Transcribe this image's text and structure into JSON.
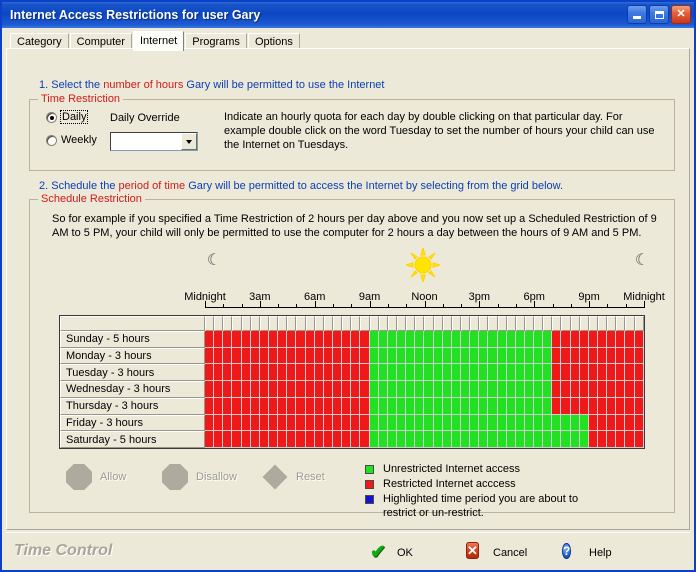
{
  "window": {
    "title": "Internet Access Restrictions for user Gary",
    "minimize_label": "Minimize",
    "maximize_label": "Maximize",
    "close_label": "Close"
  },
  "tabs": [
    {
      "label": "Category",
      "active": false
    },
    {
      "label": "Computer",
      "active": false
    },
    {
      "label": "Internet",
      "active": true
    },
    {
      "label": "Programs",
      "active": false
    },
    {
      "label": "Options",
      "active": false
    }
  ],
  "step1": {
    "prefix": "1. Select the ",
    "highlight": "number of hours",
    "suffix": " Gary will be permitted to use the Internet"
  },
  "time_restriction": {
    "group_label": "Time Restriction",
    "daily_label": "Daily",
    "weekly_label": "Weekly",
    "selected": "Daily",
    "override_label": "Daily Override",
    "override_value": "",
    "override_placeholder": "",
    "description": "Indicate an hourly quota for each day by double clicking on that particular day. For example double click on the word Tuesday to set the number of hours your child can use the Internet  on Tuesdays."
  },
  "step2": {
    "prefix": "2. Schedule the ",
    "highlight": "period of time",
    "suffix": " Gary will be permitted to access the Internet by selecting from the grid below."
  },
  "schedule_restriction": {
    "group_label": "Schedule Restriction",
    "description": "So for example if you specified a Time Restriction of 2 hours per day above and you now set up a Scheduled Restriction of 9 AM to 5 PM, your child will only be permitted to use the computer for 2 hours a day between the hours of 9 AM and 5 PM."
  },
  "time_axis": {
    "labels": [
      "Midnight",
      "3am",
      "6am",
      "9am",
      "Noon",
      "3pm",
      "6pm",
      "9pm",
      "Midnight"
    ],
    "left_icon": "moon-icon",
    "center_icon": "sun-icon",
    "right_icon": "moon-icon"
  },
  "grid": {
    "slots_per_day": 48,
    "rows": [
      {
        "day_label": "Sunday - 5 hours",
        "states": [
          "r",
          "r",
          "r",
          "r",
          "r",
          "r",
          "r",
          "r",
          "r",
          "r",
          "r",
          "r",
          "r",
          "r",
          "r",
          "r",
          "r",
          "r",
          "g",
          "g",
          "g",
          "g",
          "g",
          "g",
          "g",
          "g",
          "g",
          "g",
          "g",
          "g",
          "g",
          "g",
          "g",
          "g",
          "g",
          "g",
          "g",
          "g",
          "r",
          "r",
          "r",
          "r",
          "r",
          "r",
          "r",
          "r",
          "r",
          "r"
        ]
      },
      {
        "day_label": "Monday - 3 hours",
        "states": [
          "r",
          "r",
          "r",
          "r",
          "r",
          "r",
          "r",
          "r",
          "r",
          "r",
          "r",
          "r",
          "r",
          "r",
          "r",
          "r",
          "r",
          "r",
          "g",
          "g",
          "g",
          "g",
          "g",
          "g",
          "g",
          "g",
          "g",
          "g",
          "g",
          "g",
          "g",
          "g",
          "g",
          "g",
          "g",
          "g",
          "g",
          "g",
          "r",
          "r",
          "r",
          "r",
          "r",
          "r",
          "r",
          "r",
          "r",
          "r"
        ]
      },
      {
        "day_label": "Tuesday - 3 hours",
        "states": [
          "r",
          "r",
          "r",
          "r",
          "r",
          "r",
          "r",
          "r",
          "r",
          "r",
          "r",
          "r",
          "r",
          "r",
          "r",
          "r",
          "r",
          "r",
          "g",
          "g",
          "g",
          "g",
          "g",
          "g",
          "g",
          "g",
          "g",
          "g",
          "g",
          "g",
          "g",
          "g",
          "g",
          "g",
          "g",
          "g",
          "g",
          "g",
          "r",
          "r",
          "r",
          "r",
          "r",
          "r",
          "r",
          "r",
          "r",
          "r"
        ]
      },
      {
        "day_label": "Wednesday - 3 hours",
        "states": [
          "r",
          "r",
          "r",
          "r",
          "r",
          "r",
          "r",
          "r",
          "r",
          "r",
          "r",
          "r",
          "r",
          "r",
          "r",
          "r",
          "r",
          "r",
          "g",
          "g",
          "g",
          "g",
          "g",
          "g",
          "g",
          "g",
          "g",
          "g",
          "g",
          "g",
          "g",
          "g",
          "g",
          "g",
          "g",
          "g",
          "g",
          "g",
          "r",
          "r",
          "r",
          "r",
          "r",
          "r",
          "r",
          "r",
          "r",
          "r"
        ]
      },
      {
        "day_label": "Thursday - 3 hours",
        "states": [
          "r",
          "r",
          "r",
          "r",
          "r",
          "r",
          "r",
          "r",
          "r",
          "r",
          "r",
          "r",
          "r",
          "r",
          "r",
          "r",
          "r",
          "r",
          "g",
          "g",
          "g",
          "g",
          "g",
          "g",
          "g",
          "g",
          "g",
          "g",
          "g",
          "g",
          "g",
          "g",
          "g",
          "g",
          "g",
          "g",
          "g",
          "g",
          "r",
          "r",
          "r",
          "r",
          "r",
          "r",
          "r",
          "r",
          "r",
          "r"
        ]
      },
      {
        "day_label": "Friday - 3 hours",
        "states": [
          "r",
          "r",
          "r",
          "r",
          "r",
          "r",
          "r",
          "r",
          "r",
          "r",
          "r",
          "r",
          "r",
          "r",
          "r",
          "r",
          "r",
          "r",
          "g",
          "g",
          "g",
          "g",
          "g",
          "g",
          "g",
          "g",
          "g",
          "g",
          "g",
          "g",
          "g",
          "g",
          "g",
          "g",
          "g",
          "g",
          "g",
          "g",
          "g",
          "g",
          "g",
          "g",
          "r",
          "r",
          "r",
          "r",
          "r",
          "r"
        ]
      },
      {
        "day_label": "Saturday - 5 hours",
        "states": [
          "r",
          "r",
          "r",
          "r",
          "r",
          "r",
          "r",
          "r",
          "r",
          "r",
          "r",
          "r",
          "r",
          "r",
          "r",
          "r",
          "r",
          "r",
          "g",
          "g",
          "g",
          "g",
          "g",
          "g",
          "g",
          "g",
          "g",
          "g",
          "g",
          "g",
          "g",
          "g",
          "g",
          "g",
          "g",
          "g",
          "g",
          "g",
          "g",
          "g",
          "g",
          "g",
          "r",
          "r",
          "r",
          "r",
          "r",
          "r"
        ]
      }
    ]
  },
  "actions": [
    {
      "label": "Allow",
      "shape": "oct",
      "enabled": false
    },
    {
      "label": "Disallow",
      "shape": "oct",
      "enabled": false
    },
    {
      "label": "Reset",
      "shape": "dia",
      "enabled": false
    }
  ],
  "legend": [
    {
      "color": "#22e022",
      "text": "Unrestricted Internet access"
    },
    {
      "color": "#f01818",
      "text": "Restricted Internet acccess"
    },
    {
      "color": "#1414d2",
      "text": "Highlighted time period you are about to restrict or un-restrict."
    }
  ],
  "status_bar": {
    "brand": "Time Control",
    "ok_label": "OK",
    "cancel_label": "Cancel",
    "help_label": "Help",
    "ok_icon": "check-icon",
    "cancel_icon": "x-icon",
    "help_icon": "question-icon"
  },
  "colors": {
    "title_blue": "#0b47c3",
    "step_text": "#0a3fb5",
    "highlight_red": "#d21a1a",
    "green": "#22e022",
    "red": "#f01818",
    "blue": "#1414d2",
    "face": "#ece9d8"
  }
}
